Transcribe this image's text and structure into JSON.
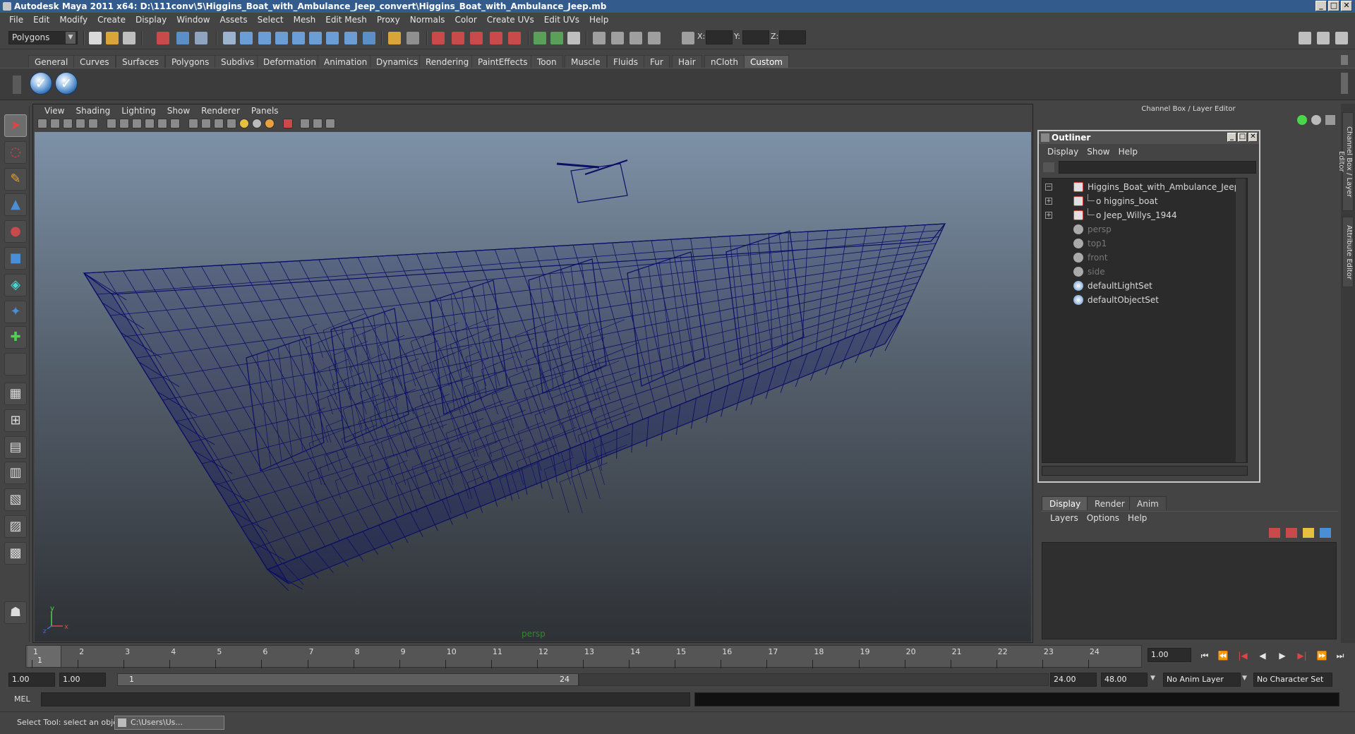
{
  "window": {
    "title": "Autodesk Maya 2011 x64: D:\\111conv\\5\\Higgins_Boat_with_Ambulance_Jeep_convert\\Higgins_Boat_with_Ambulance_Jeep.mb",
    "min": "_",
    "max": "□",
    "close": "✕"
  },
  "menubar": [
    "File",
    "Edit",
    "Modify",
    "Create",
    "Display",
    "Window",
    "Assets",
    "Select",
    "Mesh",
    "Edit Mesh",
    "Proxy",
    "Normals",
    "Color",
    "Create UVs",
    "Edit UVs",
    "Help"
  ],
  "status": {
    "mode": "Polygons",
    "x_label": "X:",
    "y_label": "Y:",
    "z_label": "Z:"
  },
  "shelf": {
    "tabs": [
      "General",
      "Curves",
      "Surfaces",
      "Polygons",
      "Subdivs",
      "Deformation",
      "Animation",
      "Dynamics",
      "Rendering",
      "PaintEffects",
      "Toon",
      "Muscle",
      "Fluids",
      "Fur",
      "Hair",
      "nCloth",
      "Custom"
    ],
    "active_tab": "Custom",
    "check_glyph": "✓"
  },
  "viewport": {
    "menu": [
      "View",
      "Shading",
      "Lighting",
      "Show",
      "Renderer",
      "Panels"
    ],
    "camera": "persp",
    "axis_y": "y",
    "axis_x": "x",
    "axis_z": "z",
    "wire_color": "#0b0f66"
  },
  "channel_box": {
    "title": "Channel Box / Layer Editor"
  },
  "side_tabs": [
    "Channel Box / Layer Editor",
    "Attribute Editor"
  ],
  "outliner": {
    "title": "Outliner",
    "menu": [
      "Display",
      "Show",
      "Help"
    ],
    "min": "_",
    "max": "□",
    "close": "✕",
    "items": [
      {
        "label": "Higgins_Boat_with_Ambulance_Jeep",
        "expander": "−",
        "type": "transform"
      },
      {
        "label": "o higgins_boat",
        "expander": "+",
        "type": "transform"
      },
      {
        "label": "o Jeep_Willys_1944",
        "expander": "+",
        "type": "transform"
      },
      {
        "label": "persp",
        "expander": "",
        "type": "camera"
      },
      {
        "label": "top1",
        "expander": "",
        "type": "camera"
      },
      {
        "label": "front",
        "expander": "",
        "type": "camera"
      },
      {
        "label": "side",
        "expander": "",
        "type": "camera"
      },
      {
        "label": "defaultLightSet",
        "expander": "",
        "type": "set"
      },
      {
        "label": "defaultObjectSet",
        "expander": "",
        "type": "set"
      }
    ]
  },
  "layer_editor": {
    "tabs": [
      "Display",
      "Render",
      "Anim"
    ],
    "active_tab": "Display",
    "menu": [
      "Layers",
      "Options",
      "Help"
    ]
  },
  "timeslider": {
    "ticks": [
      "1",
      "2",
      "3",
      "4",
      "5",
      "6",
      "7",
      "8",
      "9",
      "10",
      "11",
      "12",
      "13",
      "14",
      "15",
      "16",
      "17",
      "18",
      "19",
      "20",
      "21",
      "22",
      "23",
      "24"
    ],
    "current_frame": "1",
    "current_time": "1.00",
    "play_glyphs": [
      "⏮",
      "⏪",
      "|◀",
      "◀",
      "▶",
      "▶|",
      "⏩",
      "⏭"
    ]
  },
  "rangeslider": {
    "start": "1.00",
    "start2": "1.00",
    "range_start": "1",
    "range_end": "24",
    "end": "24.00",
    "end2": "48.00",
    "anim_layer": "No Anim Layer",
    "char_set": "No Character Set"
  },
  "command": {
    "label": "MEL"
  },
  "help": {
    "text": "Select Tool: select an object",
    "task": "C:\\Users\\Us..."
  },
  "colors": {
    "accent": "#335b8c",
    "wire": "#0b0f66"
  }
}
